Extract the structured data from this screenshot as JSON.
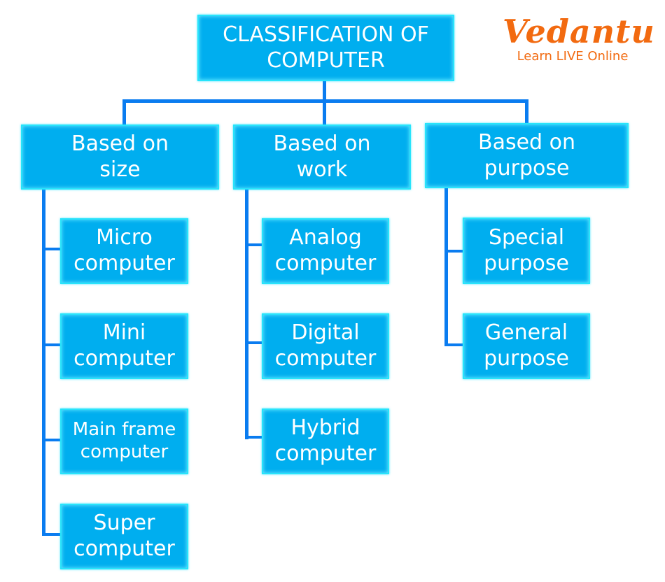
{
  "title": "CLASSIFICATION OF\nCOMPUTER",
  "logo": {
    "brand": "Vedantu",
    "tagline": "Learn LIVE Online",
    "color": "#f26a10"
  },
  "colors": {
    "node_fill": "#00aeef",
    "node_border": "#27e4fb",
    "connector": "#0a7cf0",
    "text": "#ffffff"
  },
  "categories": [
    {
      "label": "Based on\nsize",
      "children": [
        "Micro\ncomputer",
        "Mini\ncomputer",
        "Main frame\ncomputer",
        "Super\ncomputer"
      ]
    },
    {
      "label": "Based on\nwork",
      "children": [
        "Analog\ncomputer",
        "Digital\ncomputer",
        "Hybrid\ncomputer"
      ]
    },
    {
      "label": "Based on\npurpose",
      "children": [
        "Special\npurpose",
        "General\npurpose"
      ]
    }
  ]
}
